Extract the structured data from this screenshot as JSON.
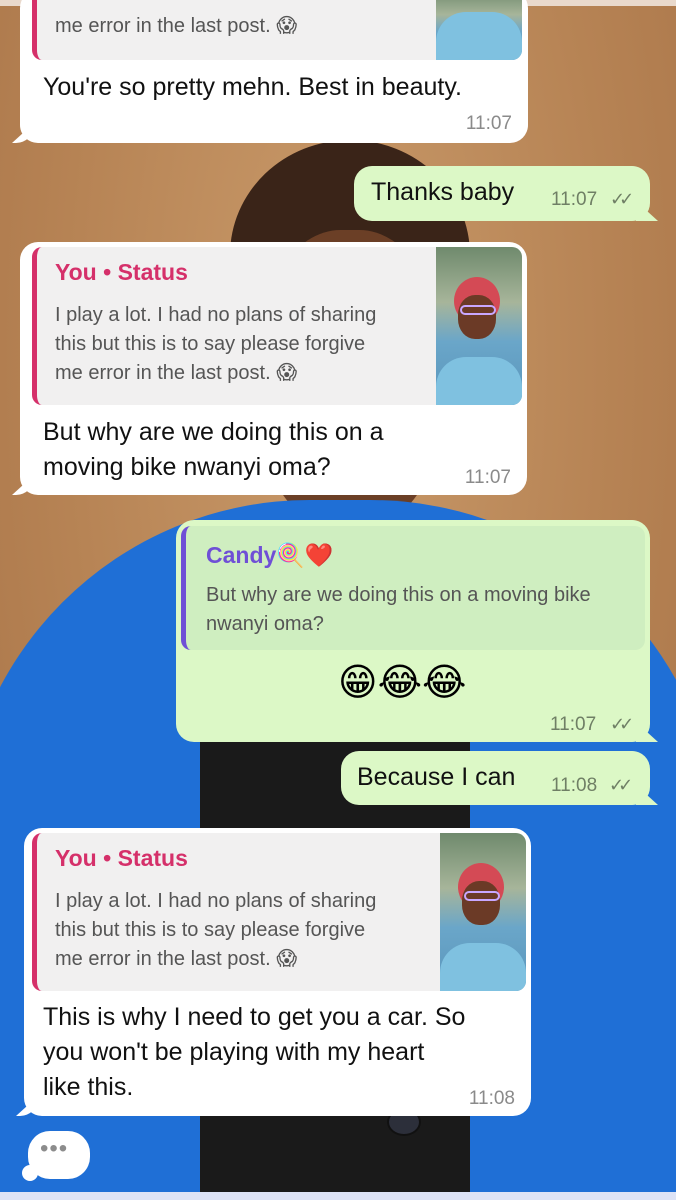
{
  "messages": {
    "m1": {
      "quote_text_partial": "me error in the last post. 😱",
      "text": "You're so pretty mehn. Best in beauty.",
      "time": "11:07"
    },
    "m2": {
      "text": "Thanks baby",
      "time": "11:07",
      "ticks": "✓✓"
    },
    "m3": {
      "quote_author": "You • Status",
      "quote_text": [
        "I play a lot. I had no plans of sharing",
        "this but this is to say please forgive",
        "me error in the last post. 😱"
      ],
      "text_lines": [
        "But why are we doing this on a",
        "moving bike nwanyi oma?"
      ],
      "time": "11:07"
    },
    "m4": {
      "quote_author": "Candy🍭❤️",
      "quote_text": [
        "But why are we doing this on a moving bike",
        "nwanyi oma?"
      ],
      "emojis": "😁😂😂",
      "time": "11:07",
      "ticks": "✓✓"
    },
    "m5": {
      "text": "Because I can",
      "time": "11:08",
      "ticks": "✓✓"
    },
    "m6": {
      "quote_author": "You • Status",
      "quote_text": [
        "I play a lot. I had no plans of sharing",
        "this but this is to say please forgive",
        "me error in the last post. 😱"
      ],
      "text_lines": [
        "This is why I need to get you a car. So",
        "you won't be playing with my heart",
        "like this."
      ],
      "time": "11:08"
    }
  },
  "typing_indicator": "•••",
  "colors": {
    "incoming_bubble": "#ffffff",
    "outgoing_bubble": "#dcf8c6",
    "status_accent": "#d5306a",
    "reply_accent": "#6f4fd6"
  }
}
